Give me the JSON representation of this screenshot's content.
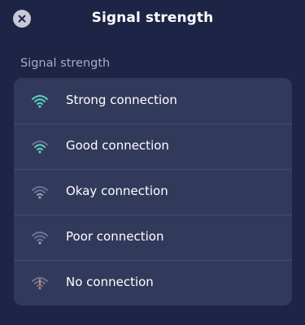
{
  "header": {
    "title": "Signal strength",
    "close_icon": "close-icon"
  },
  "section": {
    "label": "Signal strength"
  },
  "options": [
    {
      "label": "Strong connection",
      "icon": "wifi-strong-icon",
      "level": 4,
      "color": "#5fd3c0"
    },
    {
      "label": "Good connection",
      "icon": "wifi-good-icon",
      "level": 3,
      "color": "#5fd3c0"
    },
    {
      "label": "Okay connection",
      "icon": "wifi-okay-icon",
      "level": 2,
      "color": "#9aa1bd"
    },
    {
      "label": "Poor connection",
      "icon": "wifi-poor-icon",
      "level": 1,
      "color": "#9aa1bd"
    },
    {
      "label": "No connection",
      "icon": "wifi-none-icon",
      "level": 0,
      "color": "#e07b6e"
    }
  ],
  "colors": {
    "background": "#1d2445",
    "card": "#323a5c",
    "accent": "#5fd3c0",
    "inactive": "#6d7494",
    "error": "#e07b6e"
  }
}
